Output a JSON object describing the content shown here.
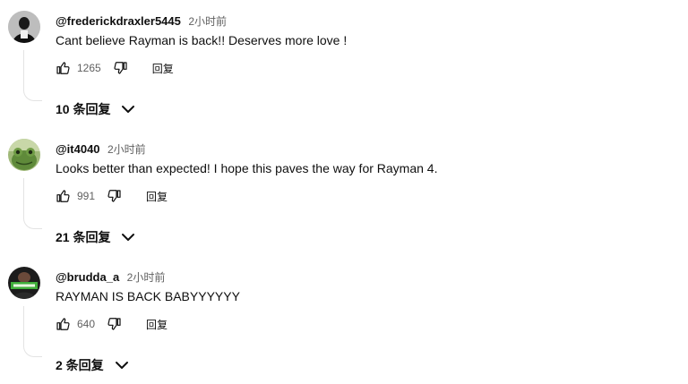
{
  "comments": [
    {
      "author": "@frederickdraxler5445",
      "time": "2小时前",
      "text": "Cant believe Rayman is back!! Deserves more love !",
      "likes": "1265",
      "reply_label": "回复",
      "replies_label": "10 条回复",
      "avatar_icon": "dark-silhouette-avatar"
    },
    {
      "author": "@it4040",
      "time": "2小时前",
      "text": "Looks better than expected! I hope this paves the way for Rayman 4.",
      "likes": "991",
      "reply_label": "回复",
      "replies_label": "21 条回复",
      "avatar_icon": "green-frog-avatar"
    },
    {
      "author": "@brudda_a",
      "time": "2小时前",
      "text": "RAYMAN IS BACK BABYYYYYY",
      "likes": "640",
      "reply_label": "回复",
      "replies_label": "2 条回复",
      "avatar_icon": "green-banner-avatar"
    }
  ],
  "icons": {
    "like": "thumbs-up-icon",
    "dislike": "thumbs-down-icon",
    "expand": "chevron-down-icon"
  },
  "colors": {
    "text": "#0f0f0f",
    "secondary": "#606060",
    "thread_line": "#e3e3e3"
  }
}
